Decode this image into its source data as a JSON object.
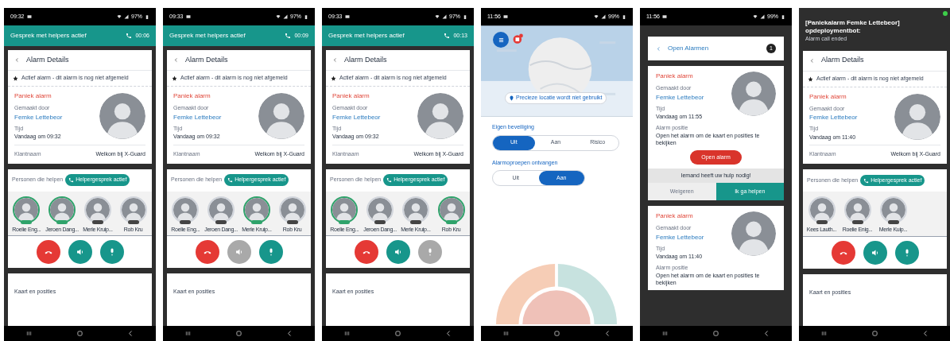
{
  "phones": [
    {
      "kind": "alarm_detail",
      "status": {
        "time": "09:32",
        "battery": "97%"
      },
      "banner": {
        "kind": "call",
        "title": "Gesprek met helpers actief",
        "timer": "00:06"
      },
      "header": "Alarm Details",
      "notice": "Actief alarm - dit alarm is nog niet afgemeld",
      "alarm": {
        "type": "Paniek alarm",
        "creator_label": "Gemaakt door",
        "creator": "Femke Lettebeor",
        "time_label": "Tijd",
        "time": "Vandaag om 09:32"
      },
      "row": {
        "label": "Klantnaam",
        "value": "Welkom bij X-Guard"
      },
      "helpers_label": "Personen die helpen",
      "call_pill": "Helpergesprek actief",
      "helpers": [
        {
          "name": "Roelie Eng...",
          "in_call": true
        },
        {
          "name": "Jeroen Dang...",
          "in_call": true
        },
        {
          "name": "Merle Kruip...",
          "in_call": false
        },
        {
          "name": "Rob Kru",
          "in_call": false
        }
      ],
      "controls": [
        {
          "kind": "hangup"
        },
        {
          "kind": "speaker",
          "on": true
        },
        {
          "kind": "mic",
          "on": true
        }
      ],
      "footer": "Kaart en posities"
    },
    {
      "kind": "alarm_detail",
      "status": {
        "time": "09:33",
        "battery": "97%"
      },
      "banner": {
        "kind": "call",
        "title": "Gesprek met helpers actief",
        "timer": "00:09"
      },
      "header": "Alarm Details",
      "notice": "Actief alarm - dit alarm is nog niet afgemeld",
      "alarm": {
        "type": "Paniek alarm",
        "creator_label": "Gemaakt door",
        "creator": "Femke Lettebeor",
        "time_label": "Tijd",
        "time": "Vandaag om 09:32"
      },
      "row": {
        "label": "Klantnaam",
        "value": "Welkom bij X-Guard"
      },
      "helpers_label": "Personen die helpen",
      "call_pill": "Helpergesprek actief",
      "helpers": [
        {
          "name": "Roelie Eng...",
          "in_call": false
        },
        {
          "name": "Jeroen Dang...",
          "in_call": false
        },
        {
          "name": "Merle Kruip...",
          "in_call": true
        },
        {
          "name": "Rob Kru",
          "in_call": false
        }
      ],
      "controls": [
        {
          "kind": "hangup"
        },
        {
          "kind": "speaker",
          "on": false
        },
        {
          "kind": "mic",
          "on": true
        }
      ],
      "footer": "Kaart en posities"
    },
    {
      "kind": "alarm_detail",
      "status": {
        "time": "09:33",
        "battery": "97%"
      },
      "banner": {
        "kind": "call",
        "title": "Gesprek met helpers actief",
        "timer": "00:13"
      },
      "header": "Alarm Details",
      "notice": "Actief alarm - dit alarm is nog niet afgemeld",
      "alarm": {
        "type": "Paniek alarm",
        "creator_label": "Gemaakt door",
        "creator": "Femke Lettebeor",
        "time_label": "Tijd",
        "time": "Vandaag om 09:32"
      },
      "row": {
        "label": "Klantnaam",
        "value": "Welkom bij X-Guard"
      },
      "helpers_label": "Personen die helpen",
      "call_pill": "Helpergesprek actief",
      "helpers": [
        {
          "name": "Roelie Eng...",
          "in_call": true
        },
        {
          "name": "Jeroen Dang...",
          "in_call": false
        },
        {
          "name": "Merle Kruip...",
          "in_call": false
        },
        {
          "name": "Rob Kru",
          "in_call": true
        }
      ],
      "controls": [
        {
          "kind": "hangup"
        },
        {
          "kind": "speaker",
          "on": true
        },
        {
          "kind": "mic",
          "on": false
        }
      ],
      "footer": "Kaart en posities"
    },
    {
      "kind": "settings",
      "status": {
        "time": "11:56",
        "battery": "99%"
      },
      "map_chip": "Precieze locatie wordt niet gebruikt",
      "groups": [
        {
          "label": "Eigen beveiliging",
          "options": [
            {
              "label": "Uit",
              "selected": true
            },
            {
              "label": "Aan",
              "selected": false
            },
            {
              "label": "Risico",
              "selected": false
            }
          ]
        },
        {
          "label": "Alarmoproepen ontvangen",
          "options": [
            {
              "label": "Uit",
              "selected": false
            },
            {
              "label": "Aan",
              "selected": true
            }
          ]
        }
      ]
    },
    {
      "kind": "open_alarms",
      "status": {
        "time": "11:56",
        "battery": "99%"
      },
      "header": "Open Alarmen",
      "count": "1",
      "alarms": [
        {
          "type": "Paniek alarm",
          "creator_label": "Gemaakt door",
          "creator": "Femke Lettebeor",
          "time_label": "Tijd",
          "time": "Vandaag om 11:55",
          "position_label": "Alarm positie",
          "position": "Open het alarm om de kaart en posities te bekijken",
          "open_button": "Open alarm",
          "help_prompt": "Iemand heeft uw hulp nodig!",
          "decline": "Weigeren",
          "accept": "Ik ga helpen"
        },
        {
          "type": "Paniek alarm",
          "creator_label": "Gemaakt door",
          "creator": "Femke Lettebeor",
          "time_label": "Tijd",
          "time": "Vandaag om 11:40",
          "position_label": "Alarm positie",
          "position": "Open het alarm om de kaart en posities te bekijken"
        }
      ]
    },
    {
      "kind": "alarm_detail",
      "banner": {
        "kind": "notification",
        "title": "[Paniekalarm Femke Lettebeor] opdeploymentbot:",
        "subtitle": "Alarm call ended"
      },
      "header": "Alarm Details",
      "notice": "Actief alarm - dit alarm is nog niet afgemeld",
      "alarm": {
        "type": "Paniek alarm",
        "creator_label": "Gemaakt door",
        "creator": "Femke Lettebeor",
        "time_label": "Tijd",
        "time": "Vandaag om 11:40"
      },
      "row": {
        "label": "Klantnaam",
        "value": "Welkom bij X-Guard"
      },
      "helpers_label": "Personen die helpen",
      "call_pill": "Helpergesprek actief",
      "helpers": [
        {
          "name": "Kees Lauth...",
          "in_call": false
        },
        {
          "name": "Roelie Enig...",
          "in_call": false
        },
        {
          "name": "Merle Kuip...",
          "in_call": false
        }
      ],
      "controls": [
        {
          "kind": "hangup"
        },
        {
          "kind": "speaker",
          "on": true
        },
        {
          "kind": "mic",
          "on": true
        }
      ],
      "footer": "Kaart en posities"
    }
  ]
}
